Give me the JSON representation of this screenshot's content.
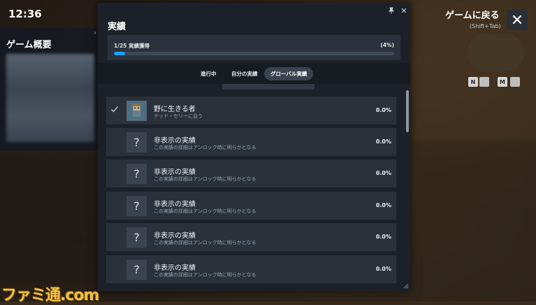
{
  "clock": {
    "time": "12:36",
    "subtext": ""
  },
  "overview": {
    "title": "ゲーム概要"
  },
  "back": {
    "label": "ゲームに戻る",
    "shortcut": "(Shift+Tab)"
  },
  "keys": [
    "N",
    "M"
  ],
  "watermark": "ファミ通.com",
  "panel": {
    "title": "実績",
    "progress": {
      "label": "1/25 実績獲得",
      "percent_text": "(4%)",
      "fraction": 0.04
    },
    "tabs": [
      {
        "label": "進行中",
        "active": false
      },
      {
        "label": "自分の実績",
        "active": false
      },
      {
        "label": "グローバル実績",
        "active": true
      }
    ],
    "achievements": [
      {
        "name": "野に生きる者",
        "desc": "テッド・セリーに会う",
        "pct": "0.0%",
        "unlocked": true,
        "icon": "achievement-thumbnail"
      },
      {
        "name": "非表示の実績",
        "desc": "この実績の詳細はアンロック時に明らかとなる",
        "pct": "0.0%",
        "unlocked": false,
        "icon": "question-icon"
      },
      {
        "name": "非表示の実績",
        "desc": "この実績の詳細はアンロック時に明らかとなる",
        "pct": "0.0%",
        "unlocked": false,
        "icon": "question-icon"
      },
      {
        "name": "非表示の実績",
        "desc": "この実績の詳細はアンロック時に明らかとなる",
        "pct": "0.0%",
        "unlocked": false,
        "icon": "question-icon"
      },
      {
        "name": "非表示の実績",
        "desc": "この実績の詳細はアンロック時に明らかとなる",
        "pct": "0.0%",
        "unlocked": false,
        "icon": "question-icon"
      },
      {
        "name": "非表示の実績",
        "desc": "この実績の詳細はアンロック時に明らかとなる",
        "pct": "0.0%",
        "unlocked": false,
        "icon": "question-icon"
      }
    ],
    "question_glyph": "?"
  },
  "colors": {
    "accent": "#1a9fff",
    "panel_bg": "#1c2129",
    "row_bg": "#2a313b"
  }
}
